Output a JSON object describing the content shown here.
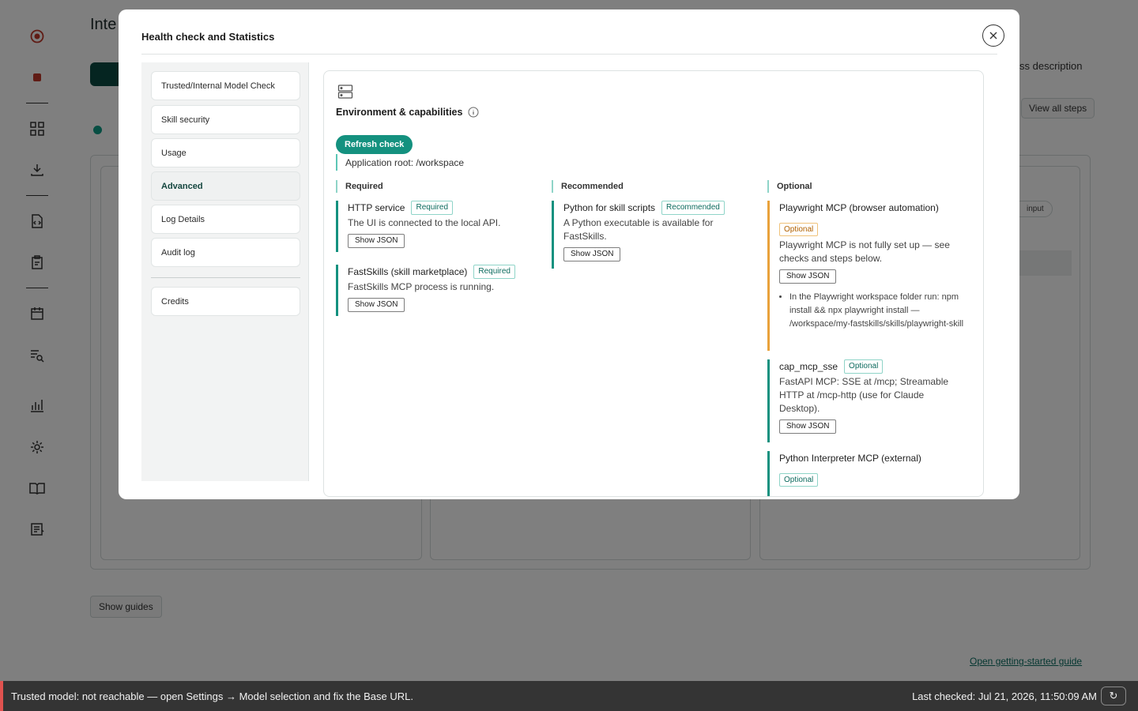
{
  "background": {
    "title": "Inte",
    "description_fragment": "ss description",
    "view_all_steps": "View all steps",
    "input_pill": "input",
    "show_guides": "Show guides",
    "getting_started_link": "Open getting-started guide"
  },
  "modal": {
    "title": "Health check and Statistics",
    "close_label": "×",
    "nav": [
      {
        "label": "Trusted/Internal Model Check"
      },
      {
        "label": "Skill security"
      },
      {
        "label": "Usage"
      },
      {
        "label": "Advanced"
      },
      {
        "label": "Log Details"
      },
      {
        "label": "Audit log"
      },
      {
        "label": "Credits"
      }
    ],
    "active_nav": "Advanced",
    "panel": {
      "title": "Environment & capabilities",
      "refresh_button": "Refresh check",
      "app_root": "Application root: /workspace",
      "show_json": "Show JSON",
      "columns": {
        "required": {
          "heading": "Required",
          "items": [
            {
              "name": "HTTP service",
              "badge": "Required",
              "desc": "The UI is connected to the local API."
            },
            {
              "name": "FastSkills (skill marketplace)",
              "badge": "Required",
              "desc": "FastSkills MCP process is running."
            }
          ]
        },
        "recommended": {
          "heading": "Recommended",
          "items": [
            {
              "name": "Python for skill scripts",
              "badge": "Recommended",
              "desc": "A Python executable is available for FastSkills."
            }
          ]
        },
        "optional": {
          "heading": "Optional",
          "items": [
            {
              "name": "Playwright MCP (browser automation)",
              "badge": "Optional",
              "desc": "Playwright MCP is not fully set up — see checks and steps below.",
              "steps": [
                "In the Playwright workspace folder run: npm install && npx playwright install — /workspace/my-fastskills/skills/playwright-skill"
              ]
            },
            {
              "name": "cap_mcp_sse",
              "badge": "Optional",
              "desc": "FastAPI MCP: SSE at /mcp; Streamable HTTP at /mcp-http (use for Claude Desktop)."
            },
            {
              "name": "Python Interpreter MCP (external)",
              "badge": "Optional"
            }
          ]
        }
      }
    }
  },
  "status_bar": {
    "message": "Trusted model: not reachable — open Settings → Model selection and fix the Base URL.",
    "last_checked": "Last checked: Jul 21, 2026, 11:50:09 AM",
    "refresh_icon": "↻"
  },
  "colors": {
    "accent": "#14917f",
    "warning": "#e9a23b",
    "error": "#e0524f"
  }
}
